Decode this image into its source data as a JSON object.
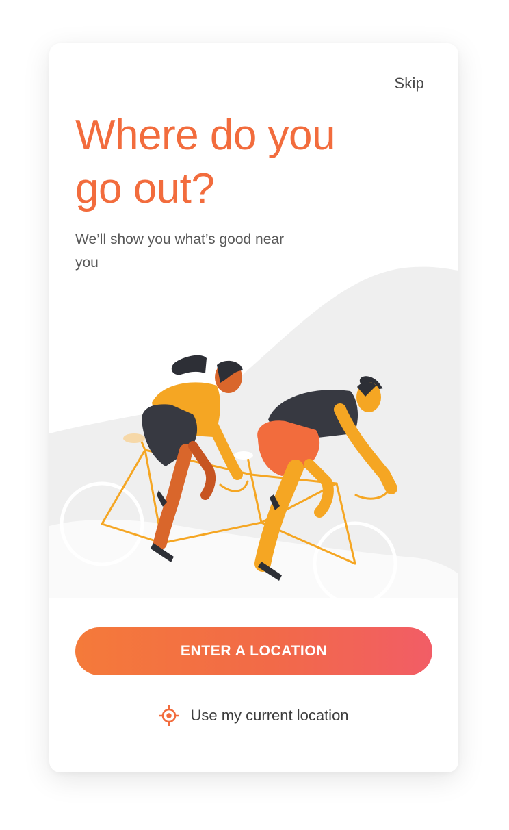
{
  "onboarding": {
    "skip_label": "Skip",
    "headline": "Where do you go out?",
    "subtitle": "We’ll show you what’s good near you",
    "primary_button_label": "ENTER A LOCATION",
    "current_location_label": "Use my current location",
    "current_location_icon": "crosshair-location-icon",
    "illustration": "tandem-bicycle-riders"
  },
  "colors": {
    "accent": "#f26c3d",
    "button_gradient_start": "#f47a3a",
    "button_gradient_end": "#f25d66",
    "body_text": "#595959"
  }
}
